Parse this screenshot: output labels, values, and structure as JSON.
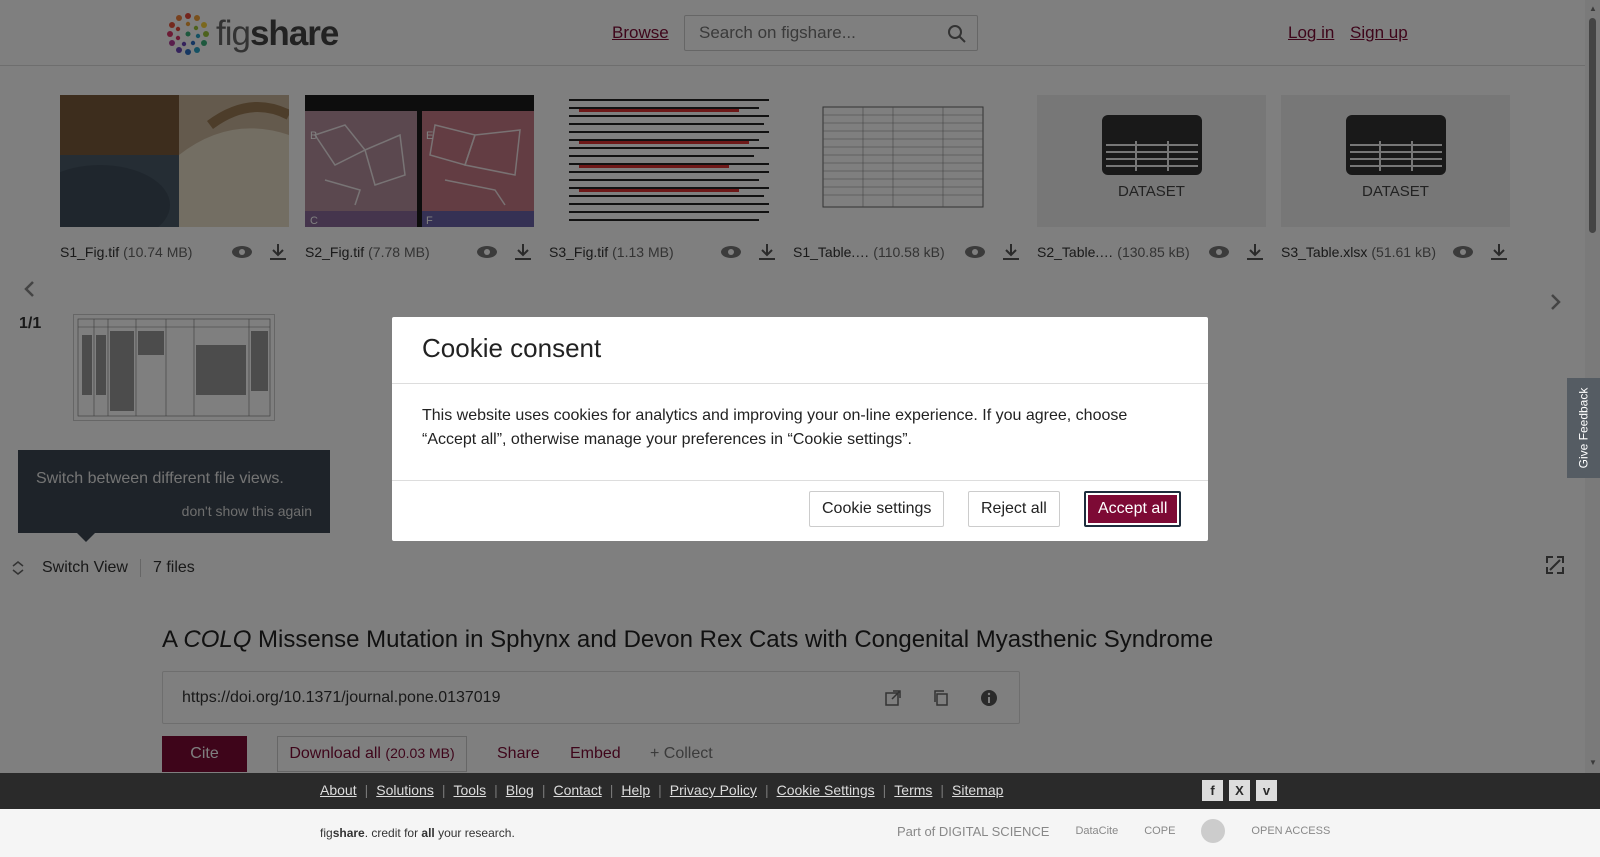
{
  "header": {
    "logo_text": "figshare",
    "browse_label": "Browse",
    "search_placeholder": "Search on figshare...",
    "login_label": "Log in",
    "signup_label": "Sign up"
  },
  "files": [
    {
      "name": "S1_Fig.tif",
      "size": "(10.74 MB)"
    },
    {
      "name": "S2_Fig.tif",
      "size": "(7.78 MB)"
    },
    {
      "name": "S3_Fig.tif",
      "size": "(1.13 MB)"
    },
    {
      "name": "S1_Table.…",
      "size": "(110.58 kB)"
    },
    {
      "name": "S2_Table.…",
      "size": "(130.85 kB)"
    },
    {
      "name": "S3_Table.xlsx",
      "size": "(51.61 kB)"
    }
  ],
  "dataset_label": "DATASET",
  "pager": "1/1",
  "tip": {
    "text": "Switch between different file views.",
    "dismiss": "don't show this again"
  },
  "switchbar": {
    "switch_label": "Switch View",
    "files_count": "7 files"
  },
  "feedback_label": "Give Feedback",
  "article": {
    "title_pre": "A ",
    "title_gene": "COLQ",
    "title_post": " Missense Mutation in Sphynx and Devon Rex Cats with Congenital Myasthenic Syndrome",
    "doi": "https://doi.org/10.1371/journal.pone.0137019",
    "cite_label": "Cite",
    "download_label": "Download all",
    "download_size": "(20.03 MB)",
    "share_label": "Share",
    "embed_label": "Embed",
    "collect_label": "+ Collect"
  },
  "modal": {
    "title": "Cookie consent",
    "body": "This website uses cookies for analytics and improving your on-line experience. If you agree, choose “Accept all”, otherwise manage your preferences in “Cookie settings”.",
    "settings_label": "Cookie settings",
    "reject_label": "Reject all",
    "accept_label": "Accept all"
  },
  "footer": {
    "links": [
      "About",
      "Solutions",
      "Tools",
      "Blog",
      "Contact",
      "Help",
      "Privacy Policy",
      "Cookie Settings",
      "Terms",
      "Sitemap"
    ],
    "tagline_pre": "fig",
    "tagline_bold": "share",
    "tagline_mid": ". credit for ",
    "tagline_all": "all",
    "tagline_post": " your research.",
    "partners": [
      "Part of DIGITAL SCIENCE",
      "DataCite",
      "COPE",
      "",
      "OPEN ACCESS"
    ]
  },
  "colors": {
    "brand": "#7d0a35",
    "overlay": "rgba(0,0,0,0.5)",
    "tip_bg": "#3c4752"
  }
}
